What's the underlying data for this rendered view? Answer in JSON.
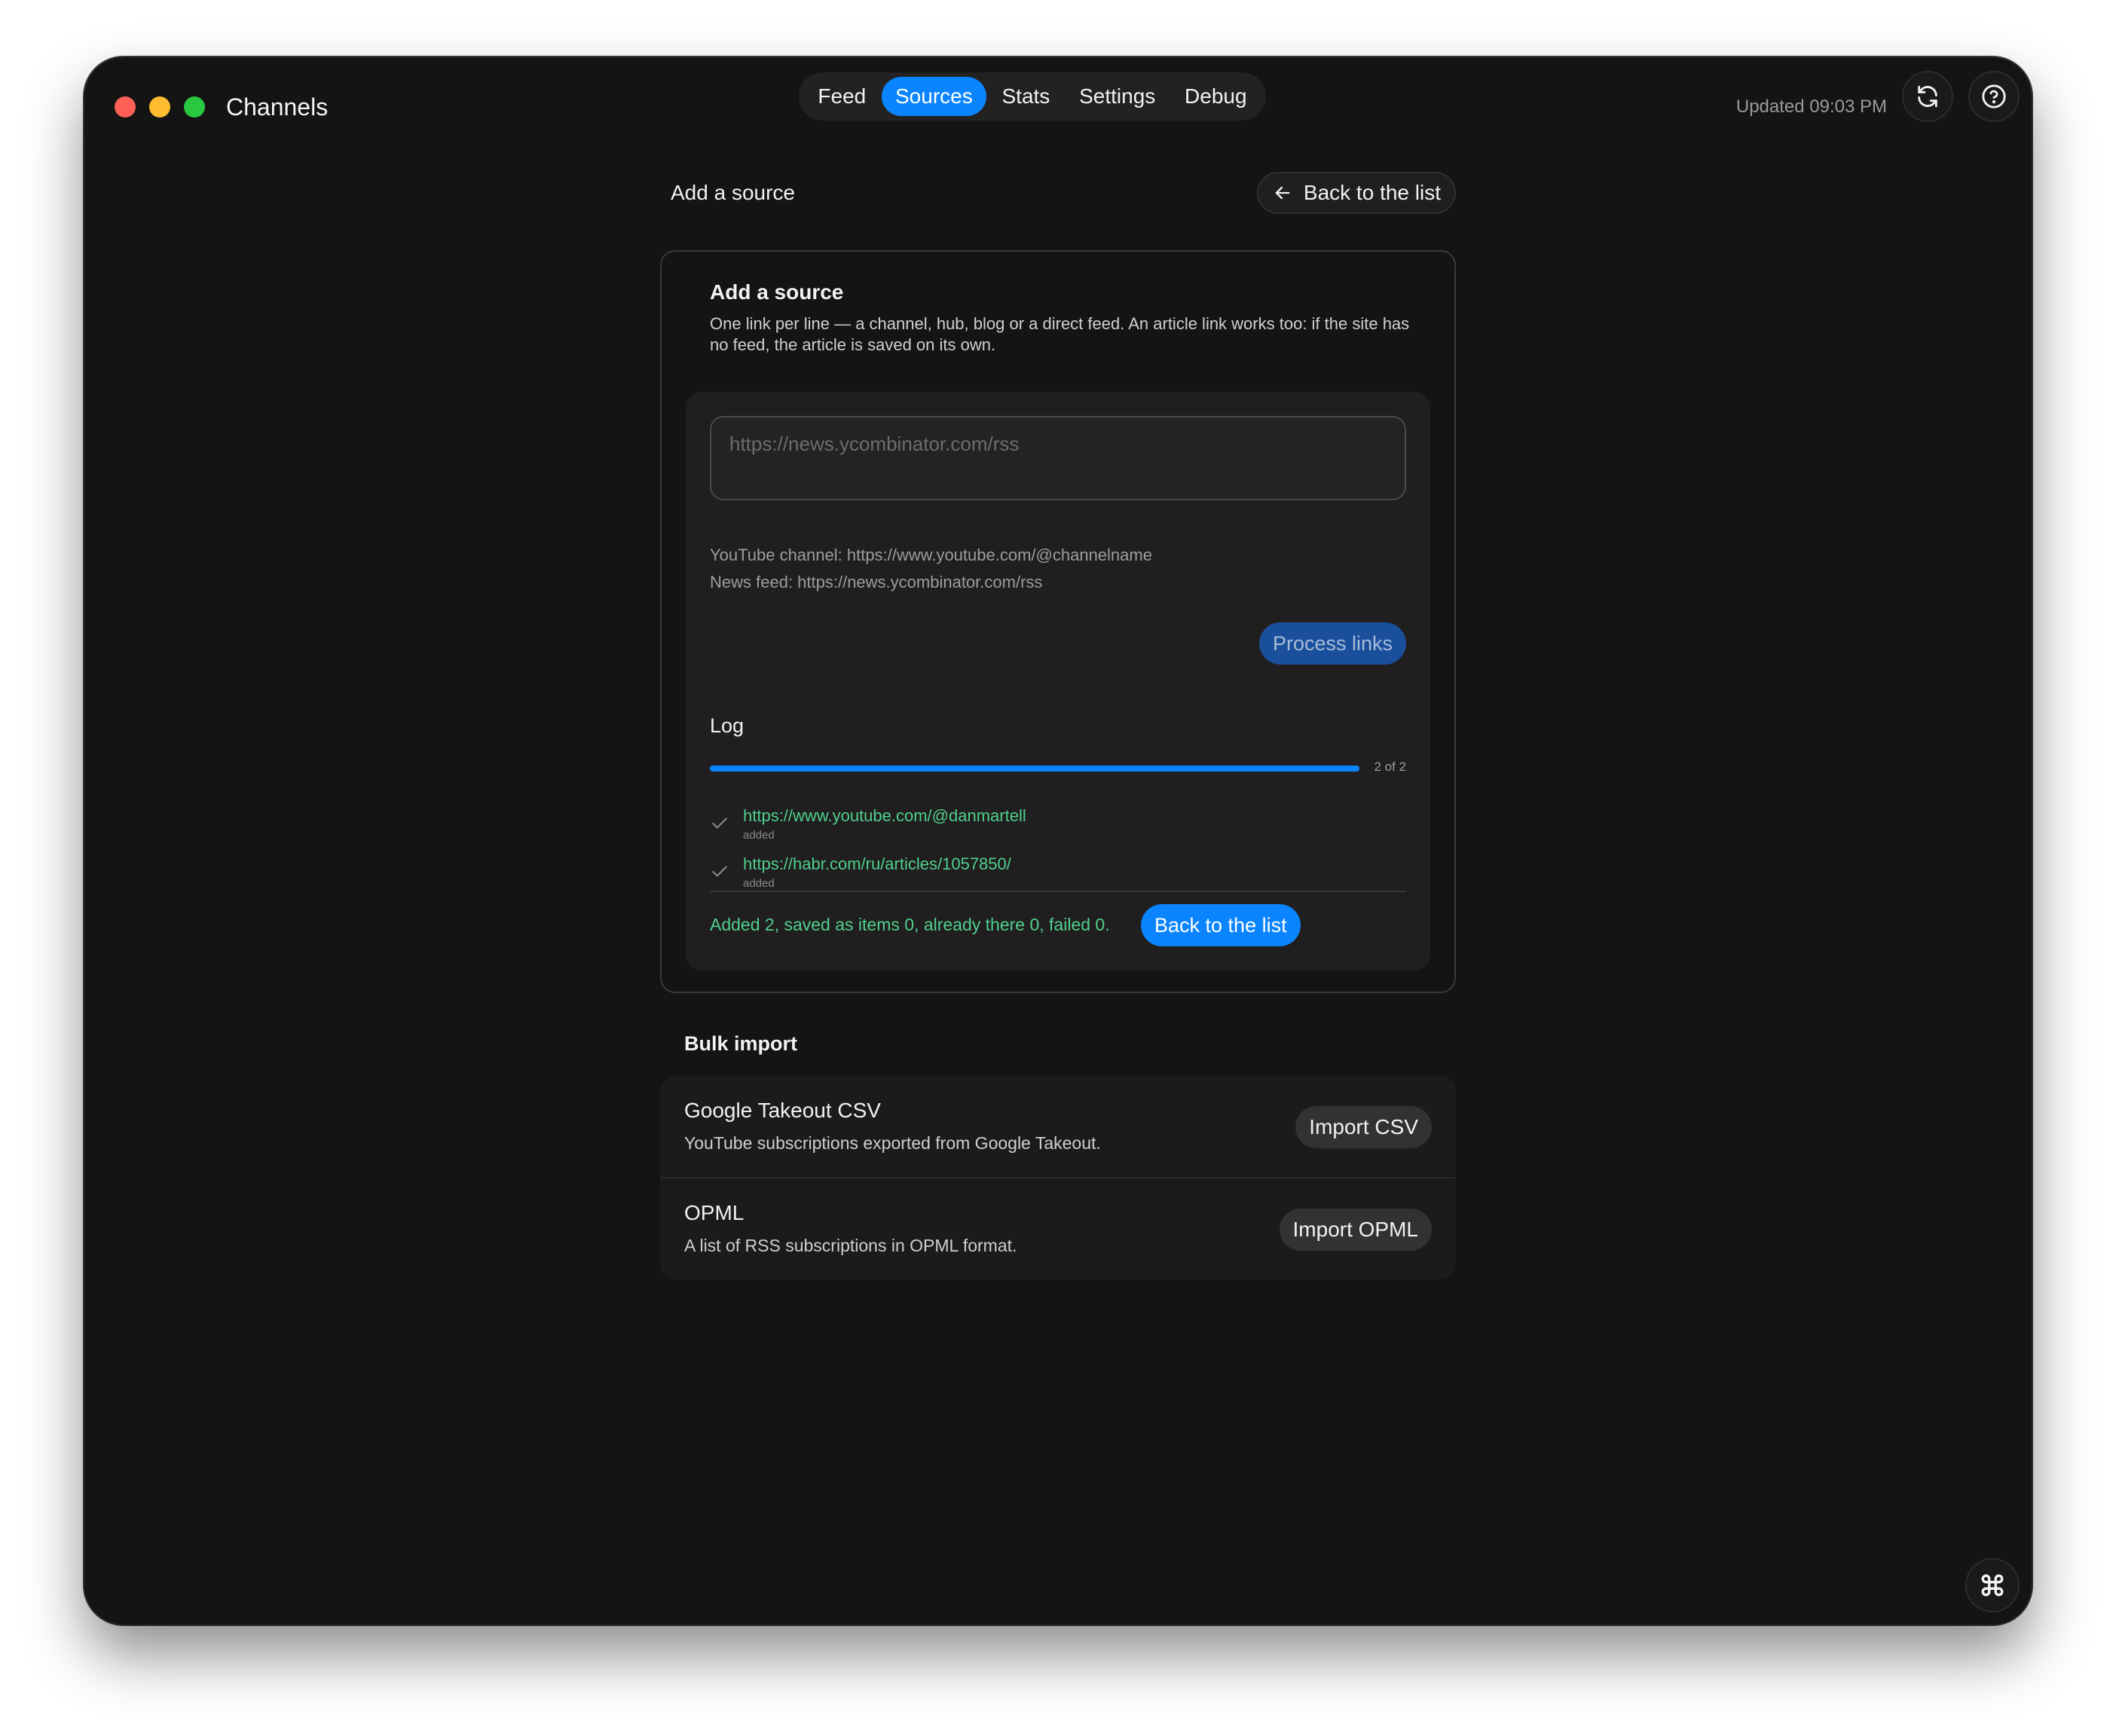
{
  "app": {
    "title": "Channels"
  },
  "nav": {
    "tabs": [
      {
        "label": "Feed",
        "active": false
      },
      {
        "label": "Sources",
        "active": true
      },
      {
        "label": "Stats",
        "active": false
      },
      {
        "label": "Settings",
        "active": false
      },
      {
        "label": "Debug",
        "active": false
      }
    ]
  },
  "header": {
    "updated": "Updated 09:03 PM",
    "refresh_icon": "refresh-icon",
    "help_icon": "help-icon"
  },
  "page": {
    "title": "Add a source",
    "back_label": "Back to the list",
    "back_icon": "arrow-left-icon"
  },
  "add_source": {
    "title": "Add a source",
    "description": "One link per line — a channel, hub, blog or a direct feed. An article link works too: if the site has no feed, the article is saved on its own.",
    "input": {
      "value": "",
      "placeholder": "https://news.ycombinator.com/rss"
    },
    "examples": [
      "YouTube channel: https://www.youtube.com/@channelname",
      "News feed: https://news.ycombinator.com/rss"
    ],
    "process_label": "Process links"
  },
  "log": {
    "title": "Log",
    "progress": {
      "done": 2,
      "total": 2,
      "text": "2 of 2"
    },
    "entries": [
      {
        "url": "https://www.youtube.com/@danmartell",
        "status": "added",
        "icon": "check-icon"
      },
      {
        "url": "https://habr.com/ru/articles/1057850/",
        "status": "added",
        "icon": "check-icon"
      }
    ],
    "summary": "Added 2, saved as items 0, already there 0, failed 0.",
    "back_label": "Back to the list"
  },
  "bulk_import": {
    "title": "Bulk import",
    "items": [
      {
        "name": "Google Takeout CSV",
        "description": "YouTube subscriptions exported from Google Takeout.",
        "button": "Import CSV"
      },
      {
        "name": "OPML",
        "description": "A list of RSS subscriptions in OPML format.",
        "button": "Import OPML"
      }
    ]
  },
  "corner_icon": "command-icon",
  "colors": {
    "accent": "#0a84ff",
    "success": "#4fd08e",
    "background": "#141414"
  }
}
